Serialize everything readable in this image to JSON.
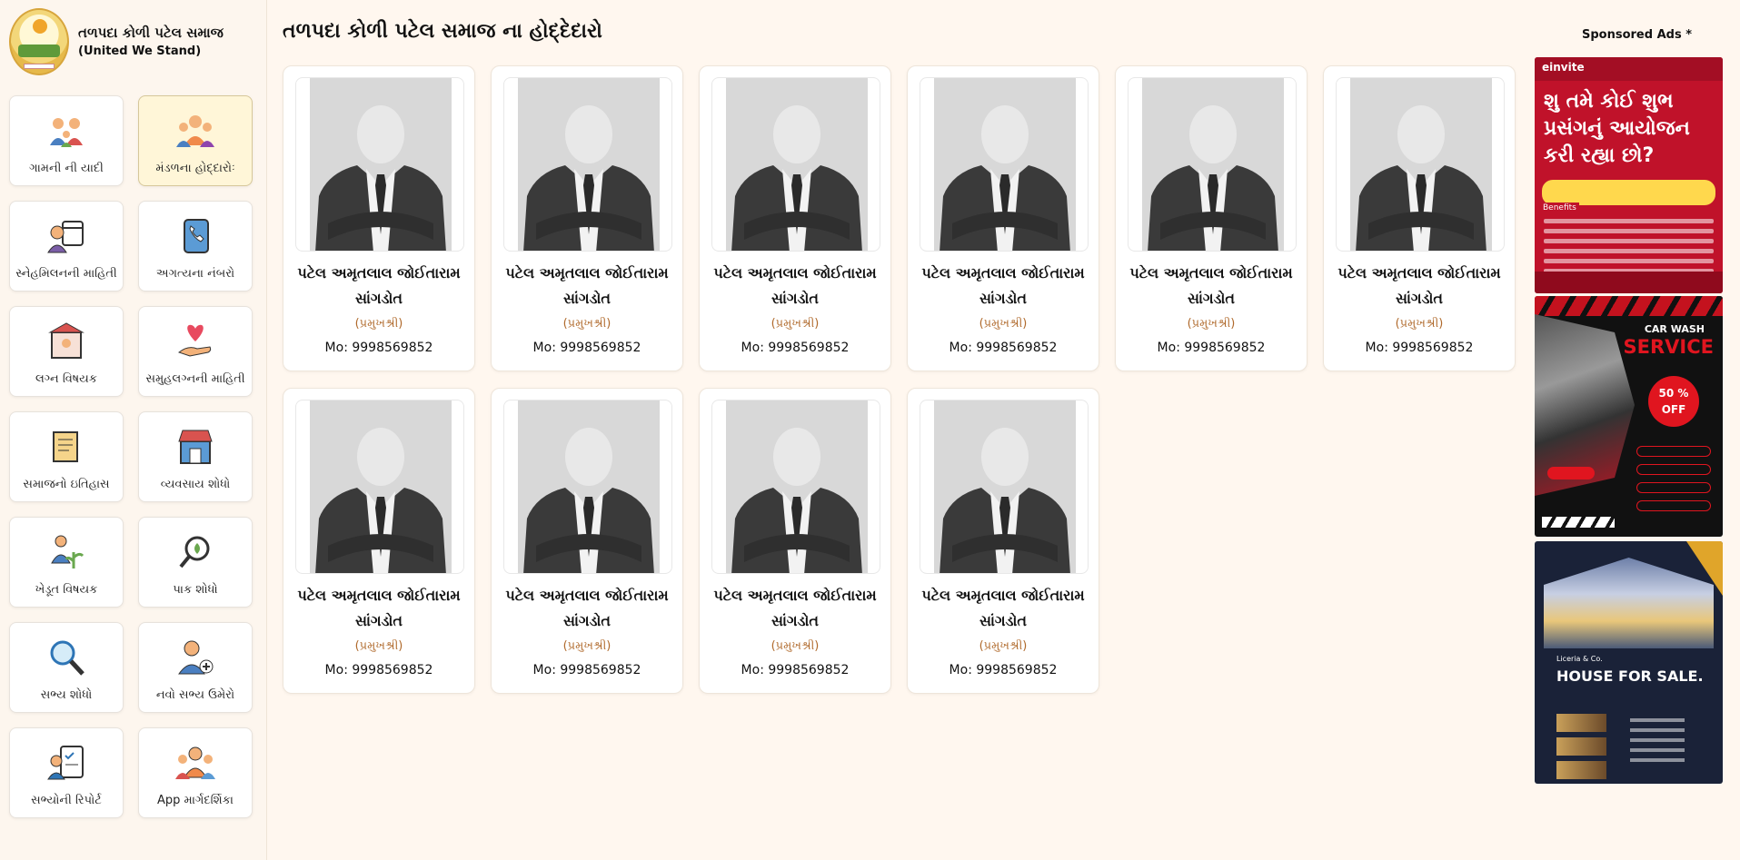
{
  "brand": {
    "title": "તળપદા કોળી પટેલ સમાજ",
    "subtitle": "(United We Stand)"
  },
  "menu": [
    {
      "label": "ગામની ની યાદી",
      "icon": "family-icon"
    },
    {
      "label": "મંડળના હોદ્દારોઃ",
      "icon": "group-icon"
    },
    {
      "label": "સ્નેહમિલનની માહિતી",
      "icon": "calendar-person-icon"
    },
    {
      "label": "અગત્યના નંબરો",
      "icon": "phonebook-icon"
    },
    {
      "label": "લગ્ન વિષયક",
      "icon": "wedding-icon"
    },
    {
      "label": "સમુહલગ્નની માહિતી",
      "icon": "heart-hand-icon"
    },
    {
      "label": "સમાજનો ઇતિહાસ",
      "icon": "scroll-icon"
    },
    {
      "label": "વ્યવસાય શોધો",
      "icon": "shop-icon"
    },
    {
      "label": "ખેડૂત વિષયક",
      "icon": "farmer-icon"
    },
    {
      "label": "પાક શોધો",
      "icon": "crop-search-icon"
    },
    {
      "label": "સભ્ય શોધો",
      "icon": "magnifier-icon"
    },
    {
      "label": "નવો સભ્ય ઉમેરો",
      "icon": "add-user-icon"
    },
    {
      "label": "સભ્યોની રિપોર્ટ",
      "icon": "report-icon"
    },
    {
      "label": "App માર્ગદર્શિકા",
      "icon": "guide-icon"
    }
  ],
  "active_menu_index": 1,
  "page": {
    "title": "તળપદા કોળી પટેલ સમાજ ના હોદ્દેદારો"
  },
  "members": [
    {
      "name": "પટેલ અમૃતલાલ જોઈતારામ સાંગડોત",
      "role": "(પ્રમુખશ્રી)",
      "mobile": "Mo: 9998569852"
    },
    {
      "name": "પટેલ અમૃતલાલ જોઈતારામ સાંગડોત",
      "role": "(પ્રમુખશ્રી)",
      "mobile": "Mo: 9998569852"
    },
    {
      "name": "પટેલ અમૃતલાલ જોઈતારામ સાંગડોત",
      "role": "(પ્રમુખશ્રી)",
      "mobile": "Mo: 9998569852"
    },
    {
      "name": "પટેલ અમૃતલાલ જોઈતારામ સાંગડોત",
      "role": "(પ્રમુખશ્રી)",
      "mobile": "Mo: 9998569852"
    },
    {
      "name": "પટેલ અમૃતલાલ જોઈતારામ સાંગડોત",
      "role": "(પ્રમુખશ્રી)",
      "mobile": "Mo: 9998569852"
    },
    {
      "name": "પટેલ અમૃતલાલ જોઈતારામ સાંગડોત",
      "role": "(પ્રમુખશ્રી)",
      "mobile": "Mo: 9998569852"
    },
    {
      "name": "પટેલ અમૃતલાલ જોઈતારામ સાંગડોત",
      "role": "(પ્રમુખશ્રી)",
      "mobile": "Mo: 9998569852"
    },
    {
      "name": "પટેલ અમૃતલાલ જોઈતારામ સાંગડોત",
      "role": "(પ્રમુખશ્રી)",
      "mobile": "Mo: 9998569852"
    },
    {
      "name": "પટેલ અમૃતલાલ જોઈતારામ સાંગડોત",
      "role": "(પ્રમુખશ્રી)",
      "mobile": "Mo: 9998569852"
    },
    {
      "name": "પટેલ અમૃતલાલ જોઈતારામ સાંગડોત",
      "role": "(પ્રમુખશ્રી)",
      "mobile": "Mo: 9998569852"
    }
  ],
  "ads": {
    "heading": "Sponsored Ads *",
    "ad1": {
      "logo": "einvite",
      "headline": "શુ તમે કોઈ શુભ પ્રસંગનું આયોજન કરી રહ્યા છો?",
      "benefits": "Benefits"
    },
    "ad2": {
      "title_small": "CAR WASH",
      "title_big": "SERVICE",
      "badge": "50 % OFF"
    },
    "ad3": {
      "brand": "Liceria & Co.",
      "title": "HOUSE FOR SALE."
    }
  },
  "colors": {
    "background": "#fff7ef",
    "role_text": "#b06a2c",
    "active_tile": "#fff6d8"
  }
}
